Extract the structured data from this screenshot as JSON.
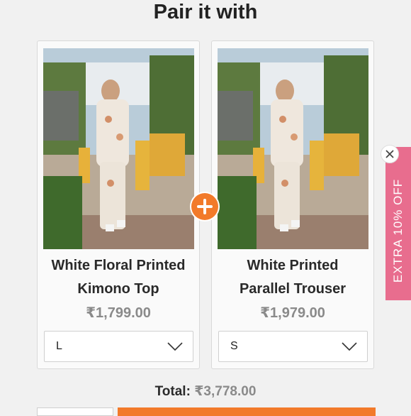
{
  "heading": "Pair it with",
  "products": [
    {
      "name_line1": "White Floral Printed",
      "name_line2": "Kimono Top",
      "price": "₹1,799.00",
      "size": "L"
    },
    {
      "name_line1": "White Printed",
      "name_line2": "Parallel Trouser",
      "price": "₹1,979.00",
      "size": "S"
    }
  ],
  "plus_icon": "plus-icon",
  "side_tab": {
    "label": "EXTRA 10% OFF"
  },
  "total": {
    "label": "Total:",
    "amount": "₹3,778.00"
  },
  "colors": {
    "accent": "#f27a2a",
    "tab": "#e86d8e",
    "price": "#8a8a8a"
  }
}
